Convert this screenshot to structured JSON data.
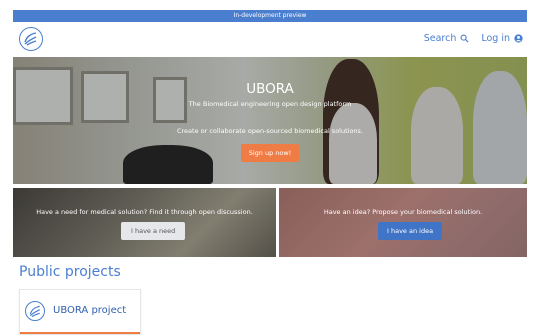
{
  "banner": {
    "text": "In-development preview"
  },
  "navbar": {
    "logo_icon": "ubora-logo-icon",
    "search_label": "Search",
    "search_icon": "search-icon",
    "login_label": "Log in",
    "login_icon": "user-circle-icon",
    "link_color": "#4a7fd0"
  },
  "hero": {
    "title": "UBORA",
    "subtitle": "The Biomedical engineering open design platform",
    "tagline": "Create or collaborate open-sourced biomedical solutions.",
    "cta_label": "Sign up now!",
    "cta_color": "#f07c45"
  },
  "panels": {
    "need": {
      "text": "Have a need for medical solution? Find it through open discussion.",
      "button_label": "I have a need"
    },
    "idea": {
      "text": "Have an idea? Propose your biomedical solution.",
      "button_label": "I have an idea",
      "button_color": "#3f74c7"
    }
  },
  "projects": {
    "section_title": "Public projects",
    "items": [
      {
        "title": "UBORA project",
        "icon": "ubora-logo-icon"
      }
    ]
  }
}
